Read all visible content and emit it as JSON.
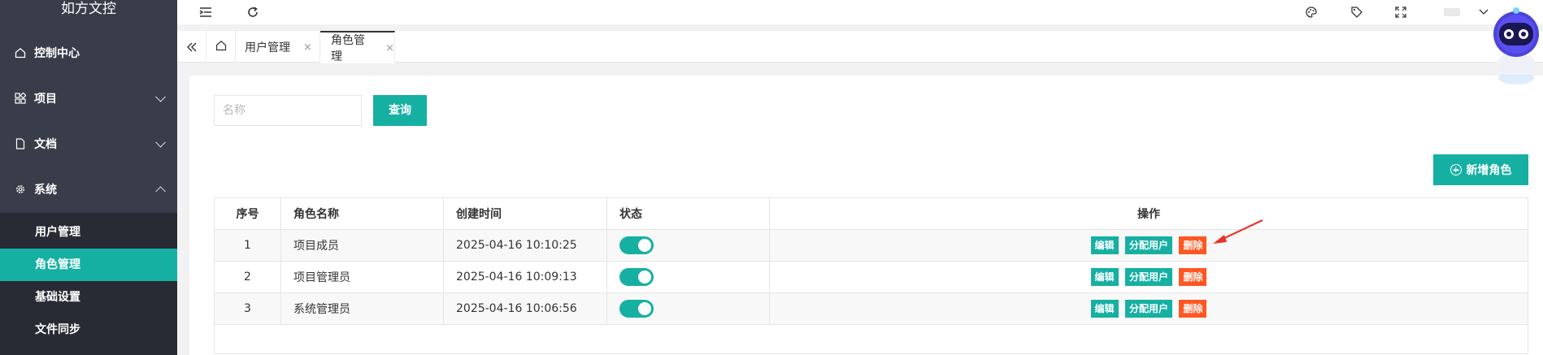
{
  "app": {
    "title": "如方文控"
  },
  "sidebar": {
    "items": [
      {
        "label": "控制中心",
        "icon": "home-icon"
      },
      {
        "label": "项目",
        "icon": "apps-icon"
      },
      {
        "label": "文档",
        "icon": "file-icon"
      },
      {
        "label": "系统",
        "icon": "gear-icon"
      }
    ],
    "sub_items": [
      {
        "label": "用户管理"
      },
      {
        "label": "角色管理"
      },
      {
        "label": "基础设置"
      },
      {
        "label": "文件同步"
      }
    ]
  },
  "tabs": [
    {
      "label": "用户管理",
      "close": "×"
    },
    {
      "label": "角色管理",
      "close": "×"
    }
  ],
  "search": {
    "placeholder": "名称",
    "query_label": "查询"
  },
  "add_button_label": "新增角色",
  "table": {
    "headers": [
      "序号",
      "角色名称",
      "创建时间",
      "状态",
      "操作"
    ],
    "rows": [
      {
        "seq": "1",
        "name": "项目成员",
        "created": "2025-04-16 10:10:25",
        "status": true
      },
      {
        "seq": "2",
        "name": "项目管理员",
        "created": "2025-04-16 10:09:13",
        "status": true
      },
      {
        "seq": "3",
        "name": "系统管理员",
        "created": "2025-04-16 10:06:56",
        "status": true
      }
    ],
    "ops": {
      "edit": "编辑",
      "assign": "分配用户",
      "delete": "删除"
    }
  },
  "colors": {
    "accent": "#16b0a3",
    "danger": "#ff5722",
    "sidebar": "#393d49",
    "sidebar_sub": "#282b33"
  }
}
